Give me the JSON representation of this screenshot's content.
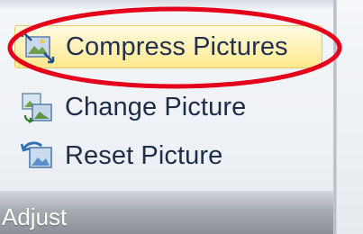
{
  "adjust_group": {
    "commands": [
      {
        "label": "Compress Pictures",
        "icon": "compress-pictures-icon"
      },
      {
        "label": "Change Picture",
        "icon": "change-picture-icon"
      },
      {
        "label": "Reset Picture",
        "icon": "reset-picture-icon"
      }
    ],
    "group_label": "Adjust"
  },
  "colors": {
    "highlight": "#ffe98d",
    "annotation": "#e4001b",
    "label_text": "#1f2d49"
  }
}
